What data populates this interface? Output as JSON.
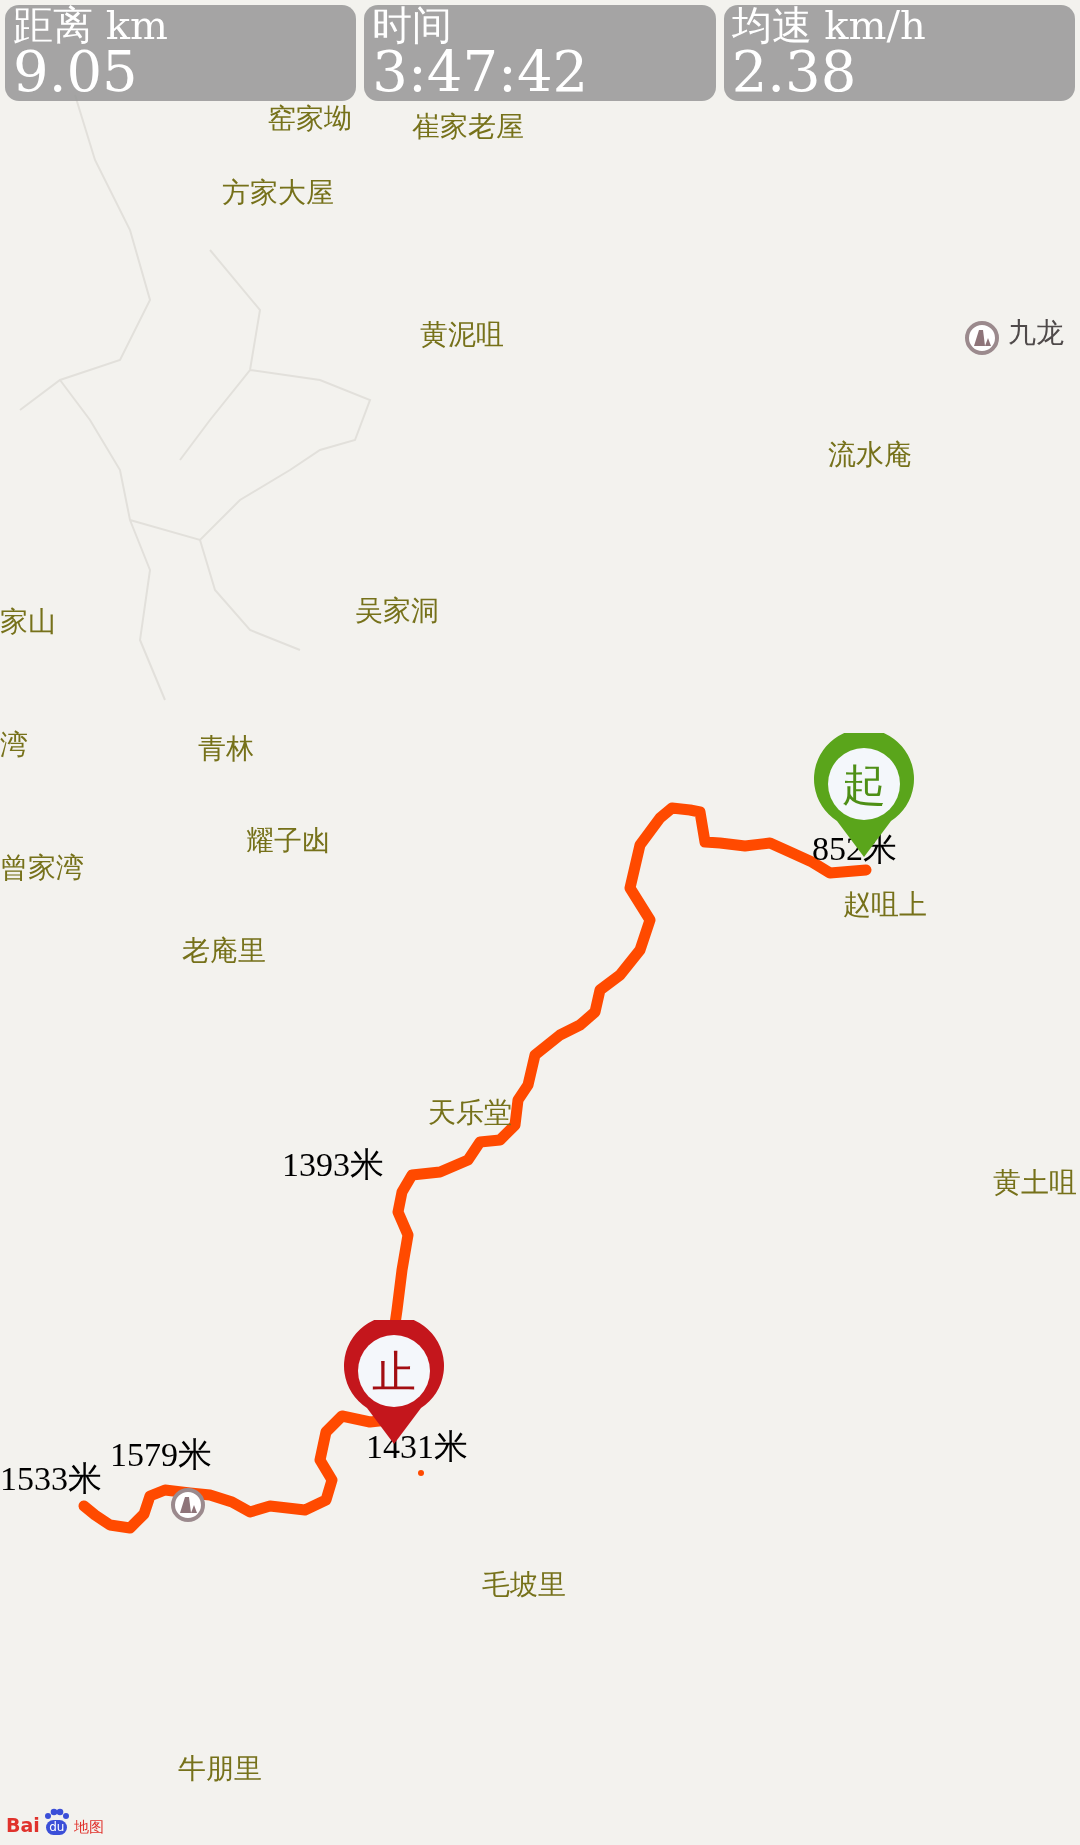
{
  "stats": [
    {
      "label": "距离 km",
      "value": "9.05"
    },
    {
      "label": "时间",
      "value": "3:47:42"
    },
    {
      "label": "均速 km/h",
      "value": "2.38"
    }
  ],
  "map": {
    "places": [
      {
        "name": "窑家坳",
        "kind": "village"
      },
      {
        "name": "崔家老屋",
        "kind": "village"
      },
      {
        "name": "方家大屋",
        "kind": "village"
      },
      {
        "name": "黄泥咀",
        "kind": "village"
      },
      {
        "name": "九龙",
        "kind": "peak"
      },
      {
        "name": "流水庵",
        "kind": "village"
      },
      {
        "name": "家山",
        "kind": "village"
      },
      {
        "name": "吴家洞",
        "kind": "village"
      },
      {
        "name": "湾",
        "kind": "village"
      },
      {
        "name": "青林",
        "kind": "village"
      },
      {
        "name": "耀子凼",
        "kind": "village"
      },
      {
        "name": "曾家湾",
        "kind": "village"
      },
      {
        "name": "赵咀上",
        "kind": "village"
      },
      {
        "name": "老庵里",
        "kind": "village"
      },
      {
        "name": "天乐堂",
        "kind": "village"
      },
      {
        "name": "黄土咀",
        "kind": "village"
      },
      {
        "name": "毛坡里",
        "kind": "village"
      },
      {
        "name": "牛朋里",
        "kind": "village"
      }
    ],
    "markers": [
      {
        "kind": "start",
        "glyph": "起"
      },
      {
        "kind": "end",
        "glyph": "止"
      }
    ],
    "elevations": [
      "852米",
      "1393米",
      "1431米",
      "1579米",
      "1533米"
    ],
    "logo": {
      "left": "Bai",
      "paw": "du",
      "right": "地图"
    }
  }
}
